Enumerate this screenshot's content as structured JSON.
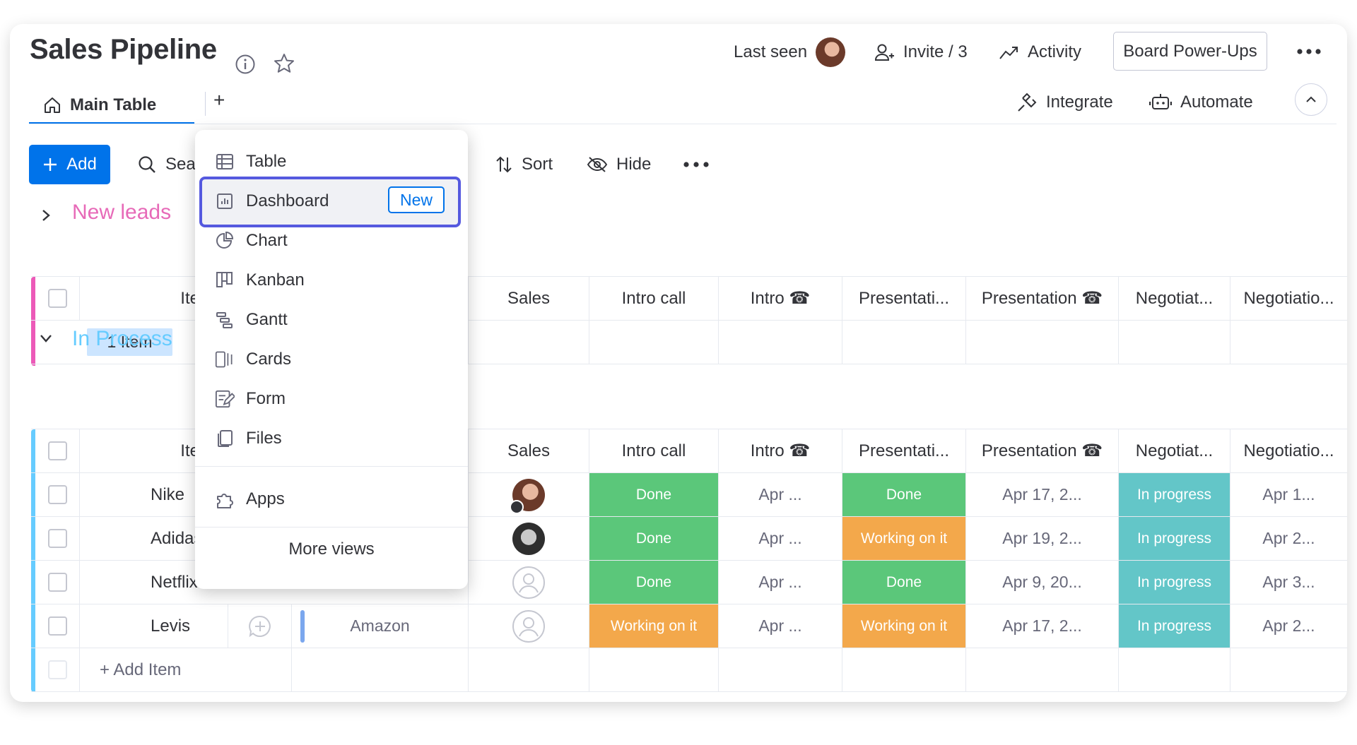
{
  "header": {
    "title": "Sales Pipeline",
    "last_seen": "Last seen",
    "invite": "Invite / 3",
    "activity": "Activity",
    "power_ups": "Board Power-Ups",
    "integrate": "Integrate",
    "automate": "Automate"
  },
  "tabs": {
    "main": "Main Table",
    "add": "+"
  },
  "toolbar": {
    "add": "Add",
    "search": "Sea",
    "sort": "Sort",
    "hide": "Hide"
  },
  "views_menu": {
    "items": [
      "Table",
      "Dashboard",
      "Chart",
      "Kanban",
      "Gantt",
      "Cards",
      "Form",
      "Files"
    ],
    "new_tag": "New",
    "apps": "Apps",
    "more": "More views"
  },
  "columns": {
    "item": "Item n",
    "sales": "Sales",
    "intro_call": "Intro call",
    "intro": "Intro ☎",
    "presentation_status": "Presentati...",
    "presentation_date": "Presentation ☎",
    "negotiation_status": "Negotiat...",
    "negotiation_date": "Negotiatio..."
  },
  "groups": [
    {
      "title": "New leads",
      "color": "#e2445c",
      "title_color": "#e76ab8",
      "bar_color": "#ec5ab8",
      "summary": "1 Item"
    },
    {
      "title": "In Process",
      "title_color": "#66ccff",
      "bar_color": "#66ccff",
      "rows": [
        {
          "name": "Nike",
          "company": "",
          "intro_call": "Done",
          "intro": "Apr ...",
          "presentation": "Done",
          "presentation_date": "Apr 17, 2...",
          "negotiation": "In progress",
          "negotiation_date": "Apr 1..."
        },
        {
          "name": "Adidas",
          "company": "",
          "intro_call": "Done",
          "intro": "Apr ...",
          "presentation": "Working on it",
          "presentation_date": "Apr 19, 2...",
          "negotiation": "In progress",
          "negotiation_date": "Apr 2..."
        },
        {
          "name": "Netflix",
          "company": "",
          "intro_call": "Done",
          "intro": "Apr ...",
          "presentation": "Done",
          "presentation_date": "Apr 9, 20...",
          "negotiation": "In progress",
          "negotiation_date": "Apr 3..."
        },
        {
          "name": "Levis",
          "company": "Amazon",
          "intro_call": "Working on it",
          "intro": "Apr ...",
          "presentation": "Working on it",
          "presentation_date": "Apr 17, 2...",
          "negotiation": "In progress",
          "negotiation_date": "Apr 2..."
        }
      ],
      "add_item": "+ Add Item"
    }
  ],
  "colors": {
    "primary": "#0073ea",
    "done": "#5bc77a",
    "working": "#f3a84b",
    "in_progress": "#63c6c8",
    "highlight": "#5559df"
  }
}
